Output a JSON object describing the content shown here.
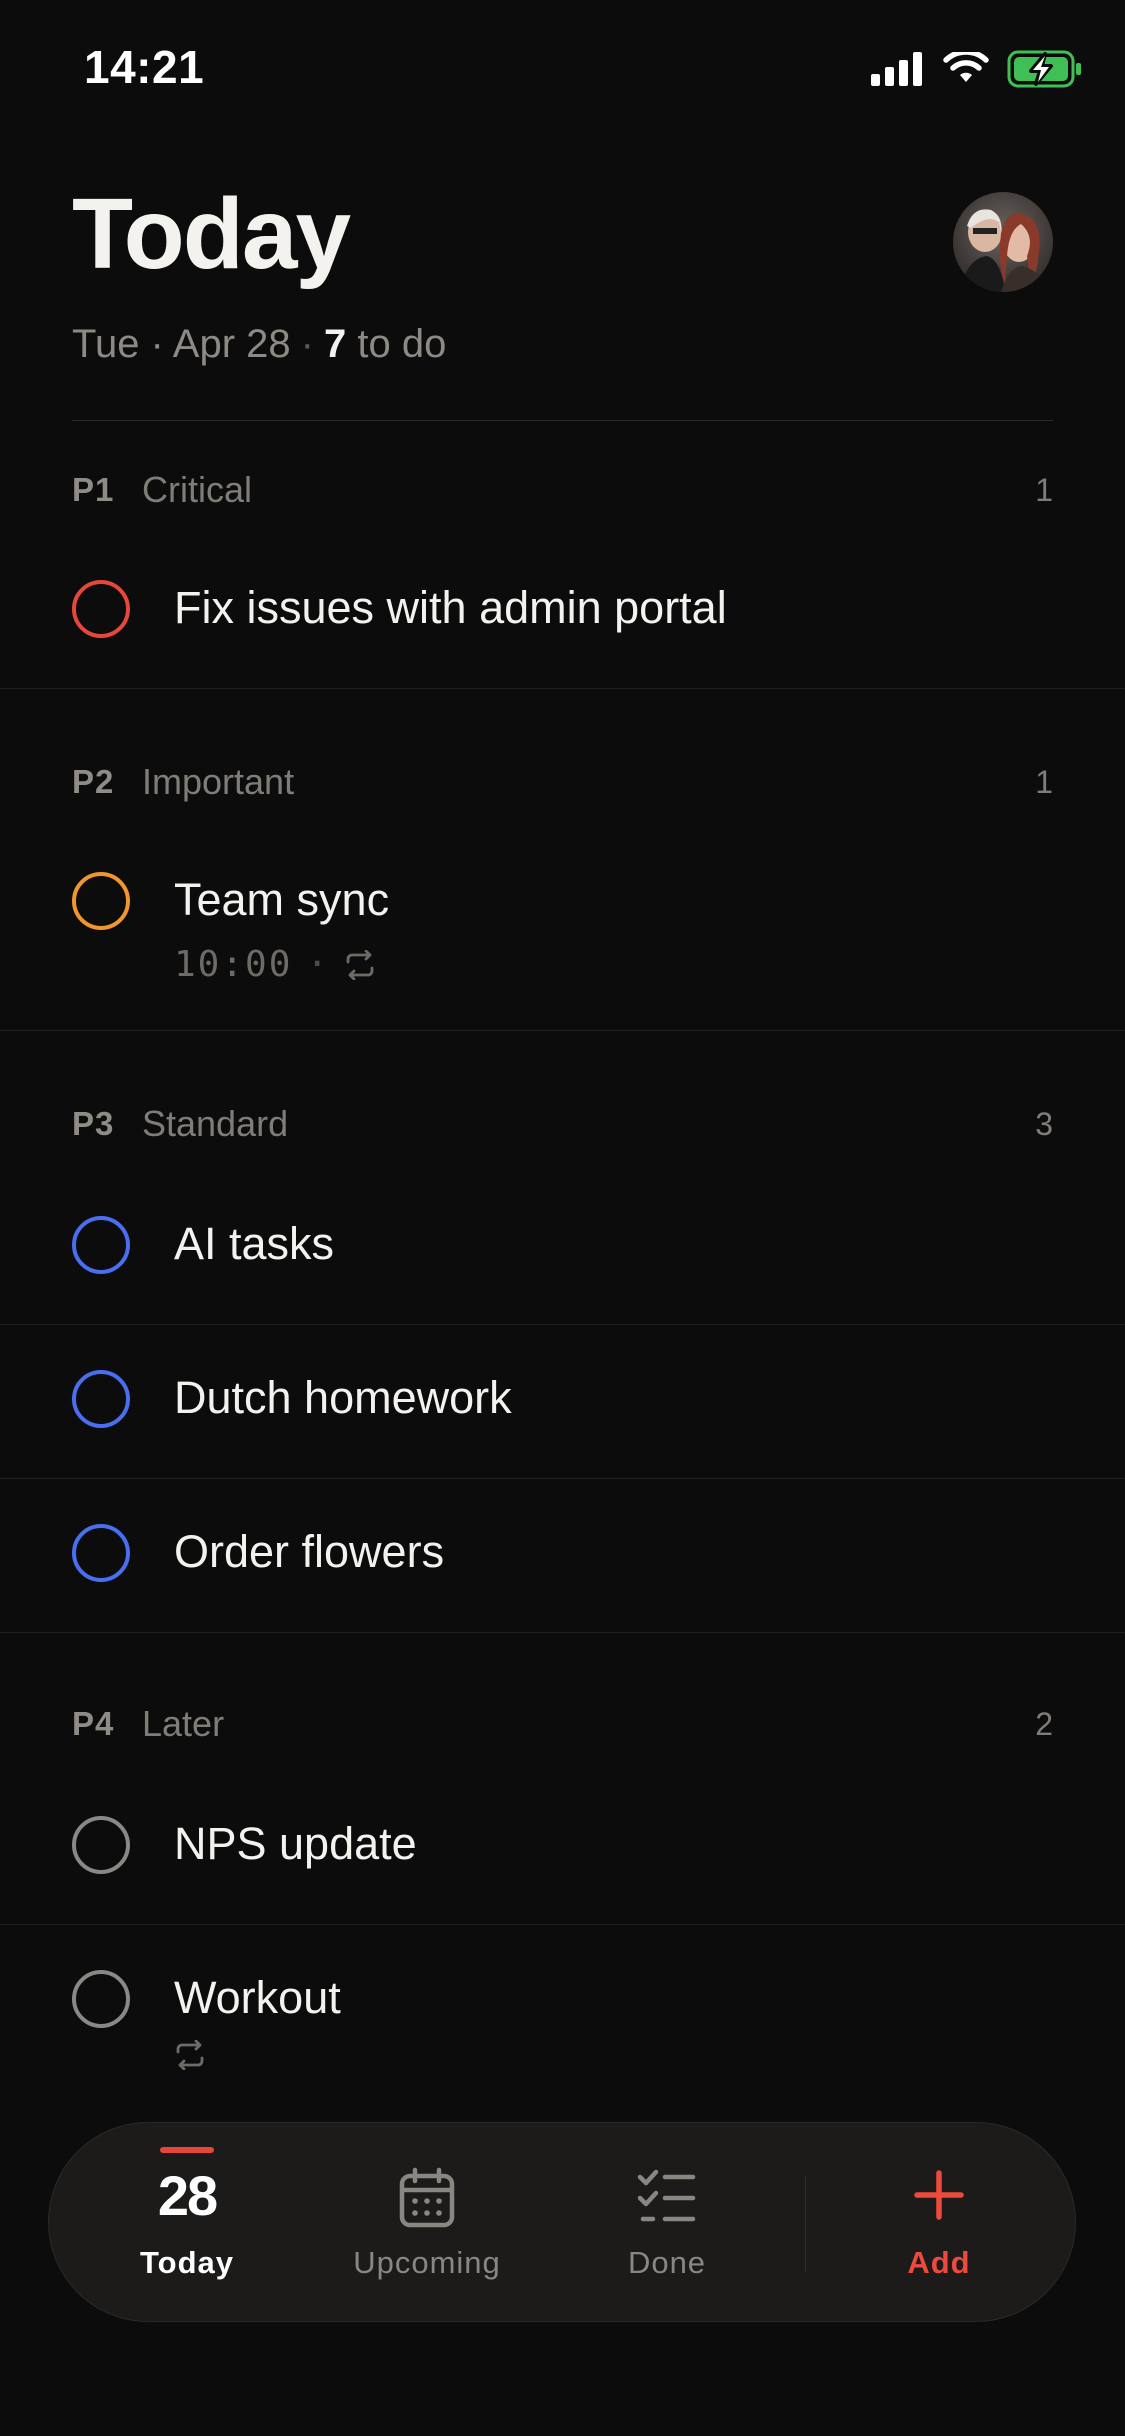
{
  "status_bar": {
    "time": "14:21"
  },
  "header": {
    "title": "Today",
    "date": "Tue · Apr 28",
    "separator": "·",
    "todo_count": "7",
    "todo_suffix": "to do"
  },
  "sections": [
    {
      "code": "P1",
      "name": "Critical",
      "count": "1",
      "color": "#e5483a",
      "tasks": [
        {
          "title": "Fix issues with admin portal"
        }
      ]
    },
    {
      "code": "P2",
      "name": "Important",
      "count": "1",
      "color": "#f0962f",
      "tasks": [
        {
          "title": "Team sync",
          "time": "10:00",
          "recurring": true
        }
      ]
    },
    {
      "code": "P3",
      "name": "Standard",
      "count": "3",
      "color": "#4a6ef0",
      "tasks": [
        {
          "title": "AI tasks"
        },
        {
          "title": "Dutch homework"
        },
        {
          "title": "Order flowers"
        }
      ]
    },
    {
      "code": "P4",
      "name": "Later",
      "count": "2",
      "color": "#8a8884",
      "tasks": [
        {
          "title": "NPS update"
        },
        {
          "title": "Workout",
          "recurring": true
        }
      ]
    }
  ],
  "bottom_nav": {
    "today": {
      "label": "Today",
      "date_number": "28",
      "icon": "today-indicator"
    },
    "upcoming": {
      "label": "Upcoming",
      "icon": "calendar-icon"
    },
    "done": {
      "label": "Done",
      "icon": "checklist-icon"
    },
    "add": {
      "label": "Add",
      "icon": "plus-icon",
      "color": "#ec4a3c"
    }
  }
}
